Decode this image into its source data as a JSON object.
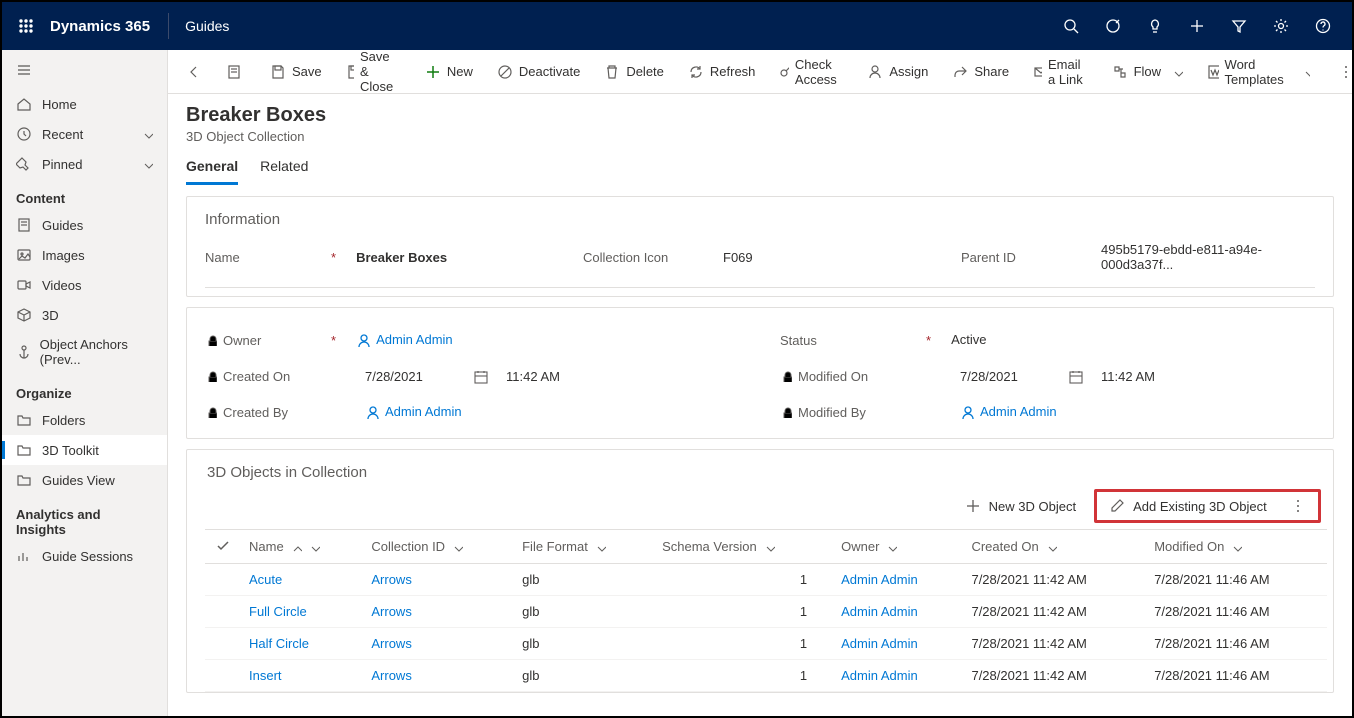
{
  "topbar": {
    "brand": "Dynamics 365",
    "app": "Guides"
  },
  "sidebar": {
    "home": "Home",
    "recent": "Recent",
    "pinned": "Pinned",
    "section_content": "Content",
    "guides": "Guides",
    "images": "Images",
    "videos": "Videos",
    "three_d": "3D",
    "object_anchors": "Object Anchors (Prev...",
    "section_organize": "Organize",
    "folders": "Folders",
    "toolkit": "3D Toolkit",
    "guides_view": "Guides View",
    "section_analytics": "Analytics and Insights",
    "guide_sessions": "Guide Sessions"
  },
  "cmd": {
    "save": "Save",
    "save_close": "Save & Close",
    "new": "New",
    "deactivate": "Deactivate",
    "delete": "Delete",
    "refresh": "Refresh",
    "check_access": "Check Access",
    "assign": "Assign",
    "share": "Share",
    "email_link": "Email a Link",
    "flow": "Flow",
    "word_templates": "Word Templates"
  },
  "header": {
    "title": "Breaker Boxes",
    "subtitle": "3D Object Collection"
  },
  "tabs": {
    "general": "General",
    "related": "Related"
  },
  "info": {
    "section": "Information",
    "name_label": "Name",
    "name_value": "Breaker Boxes",
    "icon_label": "Collection Icon",
    "icon_value": "F069",
    "parent_label": "Parent ID",
    "parent_value": "495b5179-ebdd-e811-a94e-000d3a37f...",
    "owner_label": "Owner",
    "owner_value": "Admin Admin",
    "status_label": "Status",
    "status_value": "Active",
    "created_on_label": "Created On",
    "created_on_date": "7/28/2021",
    "created_on_time": "11:42 AM",
    "modified_on_label": "Modified On",
    "modified_on_date": "7/28/2021",
    "modified_on_time": "11:42 AM",
    "created_by_label": "Created By",
    "created_by_value": "Admin Admin",
    "modified_by_label": "Modified By",
    "modified_by_value": "Admin Admin"
  },
  "subgrid": {
    "title": "3D Objects in Collection",
    "new_btn": "New 3D Object",
    "add_btn": "Add Existing 3D Object",
    "cols": {
      "name": "Name",
      "collection_id": "Collection ID",
      "file_format": "File Format",
      "schema_version": "Schema Version",
      "owner": "Owner",
      "created_on": "Created On",
      "modified_on": "Modified On"
    },
    "rows": [
      {
        "name": "Acute",
        "collection": "Arrows",
        "format": "glb",
        "schema": "1",
        "owner": "Admin Admin",
        "created": "7/28/2021 11:42 AM",
        "modified": "7/28/2021 11:46 AM"
      },
      {
        "name": "Full Circle",
        "collection": "Arrows",
        "format": "glb",
        "schema": "1",
        "owner": "Admin Admin",
        "created": "7/28/2021 11:42 AM",
        "modified": "7/28/2021 11:46 AM"
      },
      {
        "name": "Half Circle",
        "collection": "Arrows",
        "format": "glb",
        "schema": "1",
        "owner": "Admin Admin",
        "created": "7/28/2021 11:42 AM",
        "modified": "7/28/2021 11:46 AM"
      },
      {
        "name": "Insert",
        "collection": "Arrows",
        "format": "glb",
        "schema": "1",
        "owner": "Admin Admin",
        "created": "7/28/2021 11:42 AM",
        "modified": "7/28/2021 11:46 AM"
      }
    ]
  }
}
